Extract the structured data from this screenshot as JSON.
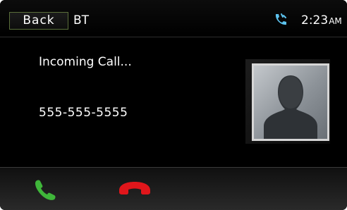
{
  "header": {
    "back_label": "Back",
    "source_label": "BT",
    "time": "2:23",
    "am_pm": "AM",
    "status_icon": "phone-ringing-icon"
  },
  "call": {
    "status": "Incoming Call...",
    "number": "555-555-5555",
    "avatar_icon": "contact-silhouette-icon"
  },
  "actions": {
    "answer_icon": "answer-call-icon",
    "decline_icon": "decline-call-icon"
  },
  "colors": {
    "background": "#000000",
    "text": "#ffffff",
    "accent_green": "#3fb63a",
    "decline_red": "#e0161b",
    "status_icon_blue": "#5cc2ee"
  }
}
